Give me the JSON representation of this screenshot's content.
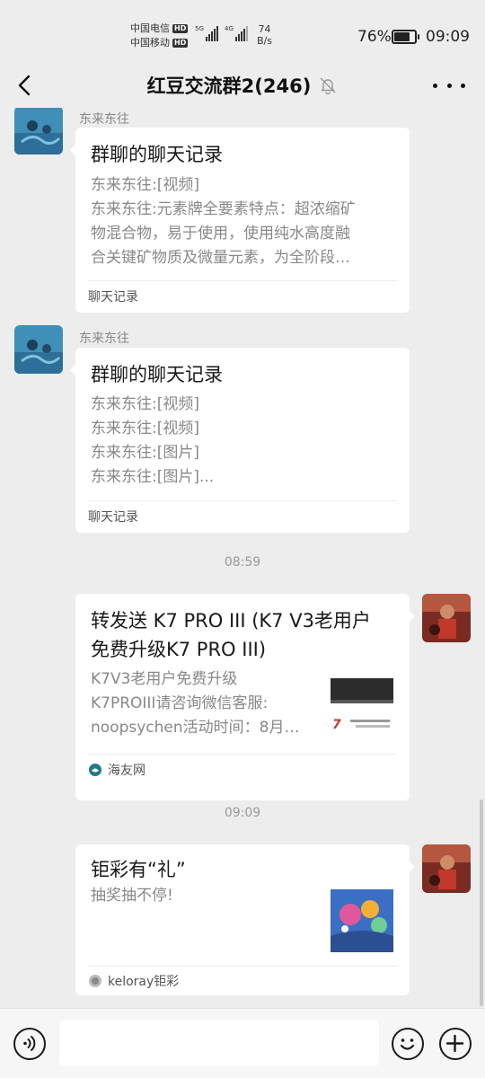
{
  "status_bar": {
    "carrier_1": "中国电信",
    "carrier_2": "中国移动",
    "hd": "HD",
    "net_1": "5G",
    "net_2": "4G",
    "speed_value": "74",
    "speed_unit": "B/s",
    "battery_percent": "76%",
    "battery_level": 0.76,
    "time": "09:09"
  },
  "header": {
    "title": "红豆交流群2(246)"
  },
  "messages": [
    {
      "sender": "东来东往",
      "title": "群聊的聊天记录",
      "lines": [
        "东来东往:[视频]",
        "东来东往:元素牌全要素特点：超浓缩矿",
        "物混合物，易于使用，使用纯水高度融",
        "合关键矿物质及微量元素，为全阶段…"
      ],
      "footer": "聊天记录"
    },
    {
      "sender": "东来东往",
      "title": "群聊的聊天记录",
      "lines": [
        "东来东往:[视频]",
        "东来东往:[视频]",
        "东来东往:[图片]",
        "东来东往:[图片]..."
      ],
      "footer": "聊天记录"
    },
    {
      "timestamp": "08:59",
      "title_1": "转发送 K7 PRO III (K7 V3老用户",
      "title_2": "免费升级K7 PRO III)",
      "lines": [
        "K7V3老用户免费升级",
        "K7PROIII请咨询微信客服:",
        "noopsychen活动时间：8月…"
      ],
      "thumb_text": "7",
      "footer": "海友网"
    },
    {
      "timestamp": "09:09",
      "title": "钜彩有“礼”",
      "lines": [
        "抽奖抽不停!"
      ],
      "footer": "keloray钜彩"
    }
  ],
  "input": {
    "placeholder": ""
  },
  "colors": {
    "background": "#ededed",
    "card": "#ffffff",
    "secondary_text": "#888888"
  }
}
